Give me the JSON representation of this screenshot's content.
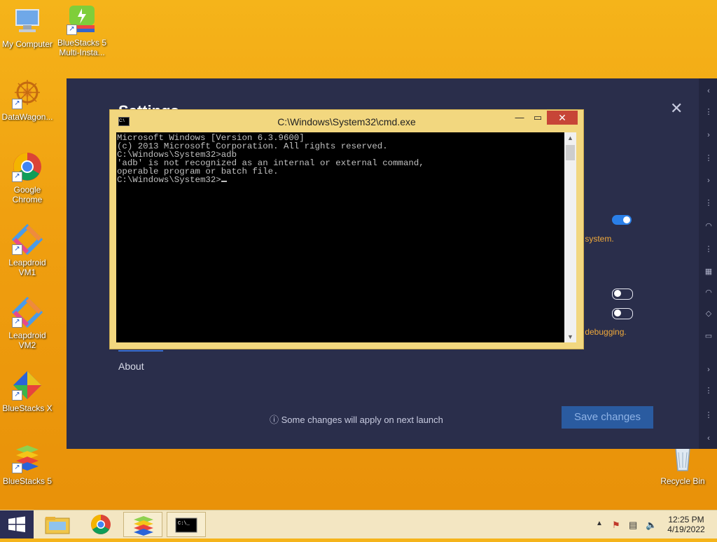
{
  "desktop_icons": [
    {
      "label_line1": "My Computer",
      "label_line2": ""
    },
    {
      "label_line1": "BlueStacks 5",
      "label_line2": "Multi-Insta..."
    },
    {
      "label_line1": "DataWagon...",
      "label_line2": ""
    },
    {
      "label_line1": "Google",
      "label_line2": "Chrome"
    },
    {
      "label_line1": "Leapdroid",
      "label_line2": "VM1"
    },
    {
      "label_line1": "Leapdroid",
      "label_line2": "VM2"
    },
    {
      "label_line1": "BlueStacks X",
      "label_line2": ""
    },
    {
      "label_line1": "BlueStacks 5",
      "label_line2": ""
    },
    {
      "label_line1": "Recycle Bin",
      "label_line2": ""
    }
  ],
  "settings": {
    "title": "Settings",
    "hint_system": "r system.",
    "hint_debugging": "r debugging.",
    "about": "About",
    "notice": "Some changes will apply on next launch",
    "save_label": "Save changes",
    "toggle_1": "on",
    "toggle_2": "off",
    "toggle_3": "off"
  },
  "cmd": {
    "title": "C:\\Windows\\System32\\cmd.exe",
    "lines": [
      "Microsoft Windows [Version 6.3.9600]",
      "(c) 2013 Microsoft Corporation. All rights reserved.",
      "",
      "C:\\Windows\\System32>adb",
      "'adb' is not recognized as an internal or external command,",
      "operable program or batch file.",
      "",
      "C:\\Windows\\System32>"
    ]
  },
  "taskbar": {
    "time": "12:25 PM",
    "date": "4/19/2022"
  },
  "colors": {
    "desktop": "#f0a010",
    "settings_bg": "#2a2e4b",
    "accent_blue": "#2a7fe8",
    "cmd_frame": "#f2d77f",
    "close_red": "#c74537"
  }
}
